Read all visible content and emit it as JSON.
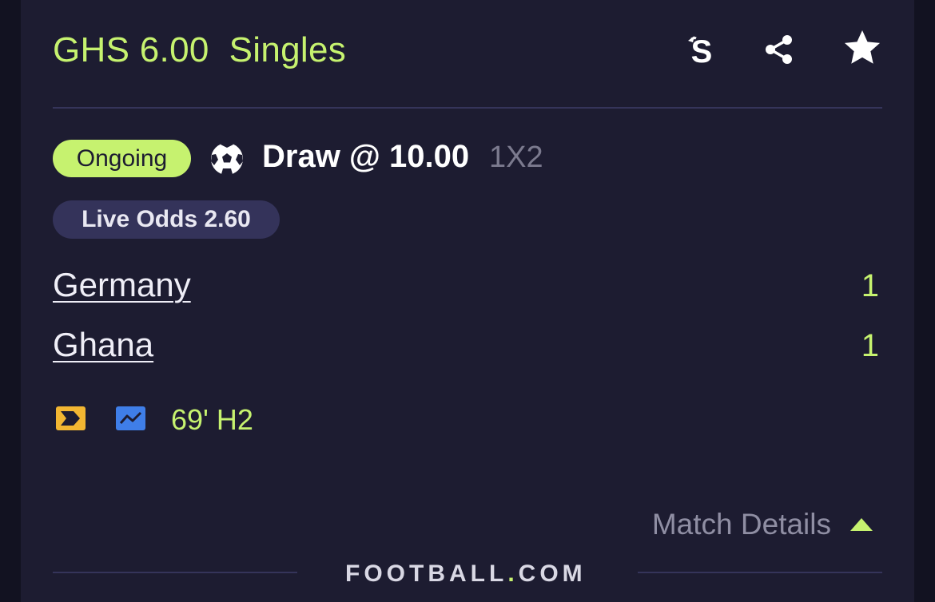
{
  "header": {
    "title": "GHS 6.00  Singles",
    "icons": [
      "sporty-s-icon",
      "share-icon",
      "star-icon"
    ]
  },
  "bet": {
    "status": "Ongoing",
    "sport_icon": "soccer-ball-icon",
    "pick": "Draw @ 10.00",
    "market": "1X2",
    "live_odds": "Live Odds 2.60"
  },
  "match": {
    "home_team": "Germany",
    "home_score": "1",
    "away_team": "Ghana",
    "away_score": "1",
    "time": "69' H2",
    "icons": [
      "live-stream-icon",
      "live-stats-icon"
    ]
  },
  "footer": {
    "details_label": "Match Details",
    "brand_part1": "FOOTBALL",
    "brand_dot": ".",
    "brand_part2": "COM"
  },
  "colors": {
    "accent": "#c6f26f",
    "card_bg": "#1d1c31",
    "pill_bg": "#34335a",
    "stream_icon": "#f2b632",
    "stats_icon": "#3f7ee8"
  }
}
